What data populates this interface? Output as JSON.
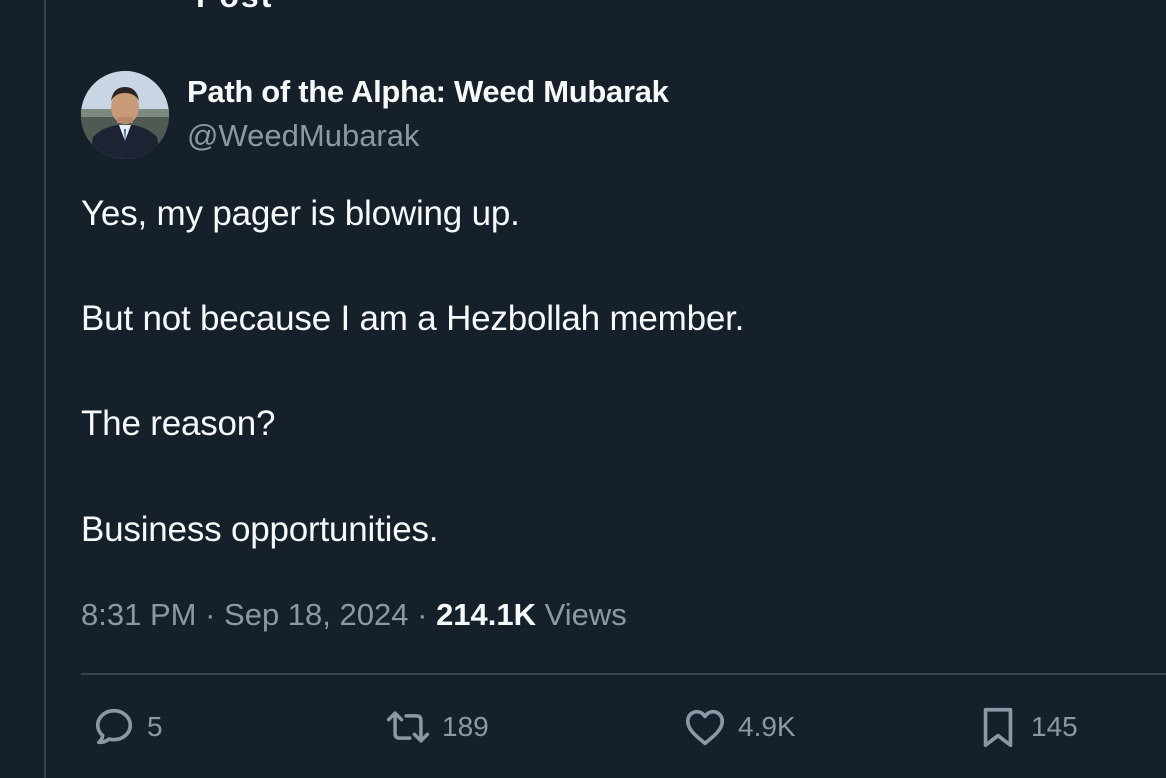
{
  "header": {
    "cutoff_title": "Post"
  },
  "author": {
    "display_name": "Path of the Alpha: Weed Mubarak",
    "handle": "@WeedMubarak",
    "avatar_icon": "user-avatar"
  },
  "tweet": {
    "lines": [
      "Yes, my pager is blowing up.",
      "But not because I am a Hezbollah member.",
      "The reason?",
      "Business opportunities."
    ]
  },
  "meta": {
    "time": "8:31 PM",
    "separator": "·",
    "date": "Sep 18, 2024",
    "views_count": "214.1K",
    "views_label": "Views"
  },
  "actions": {
    "reply": {
      "icon": "reply-icon",
      "count": "5"
    },
    "retweet": {
      "icon": "retweet-icon",
      "count": "189"
    },
    "like": {
      "icon": "heart-icon",
      "count": "4.9K"
    },
    "bookmark": {
      "icon": "bookmark-icon",
      "count": "145"
    }
  },
  "colors": {
    "background": "#15202b",
    "text_primary": "#f7f9f9",
    "text_secondary": "#8b98a5",
    "border": "#38444d"
  }
}
